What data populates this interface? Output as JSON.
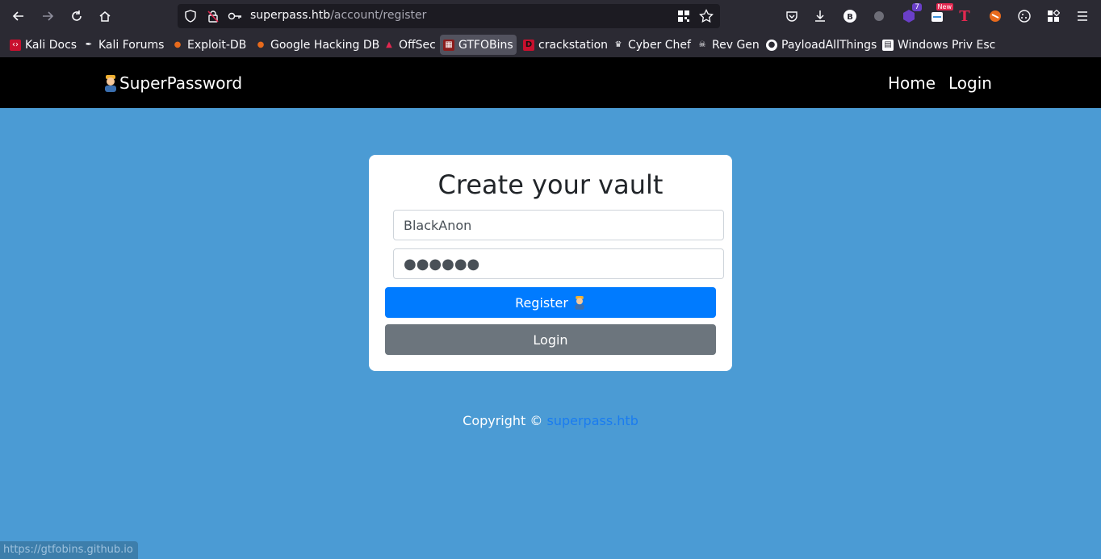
{
  "browser": {
    "url_host": "superpass.htb",
    "url_path": "/account/register",
    "status_url": "https://gtfobins.github.io",
    "new_badge": "New",
    "ext_count": "7"
  },
  "bookmarks": [
    {
      "label": "Kali Docs",
      "icon": "kali-docs-icon"
    },
    {
      "label": "Kali Forums",
      "icon": "kali-forums-icon"
    },
    {
      "label": "Exploit-DB",
      "icon": "exploit-db-icon"
    },
    {
      "label": "Google Hacking DB",
      "icon": "ghdb-icon"
    },
    {
      "label": "OffSec",
      "icon": "offsec-icon"
    },
    {
      "label": "GTFOBins",
      "icon": "gtfobins-icon"
    },
    {
      "label": "crackstation",
      "icon": "crackstation-icon"
    },
    {
      "label": "Cyber Chef",
      "icon": "cyberchef-icon"
    },
    {
      "label": "Rev Gen",
      "icon": "skull-icon"
    },
    {
      "label": "PayloadAllThings",
      "icon": "github-icon"
    },
    {
      "label": "Windows Priv Esc",
      "icon": "book-icon"
    }
  ],
  "navbar": {
    "brand": "SuperPassword",
    "links": [
      "Home",
      "Login"
    ]
  },
  "form": {
    "title": "Create your vault",
    "username_value": "BlackAnon",
    "password_value": "●●●●●●",
    "register_label": "Register",
    "login_label": "Login"
  },
  "footer": {
    "text": "Copyright ©",
    "link": "superpass.htb"
  },
  "colors": {
    "page_bg": "#4b9bd4",
    "primary": "#007bff",
    "secondary": "#6c757d"
  }
}
